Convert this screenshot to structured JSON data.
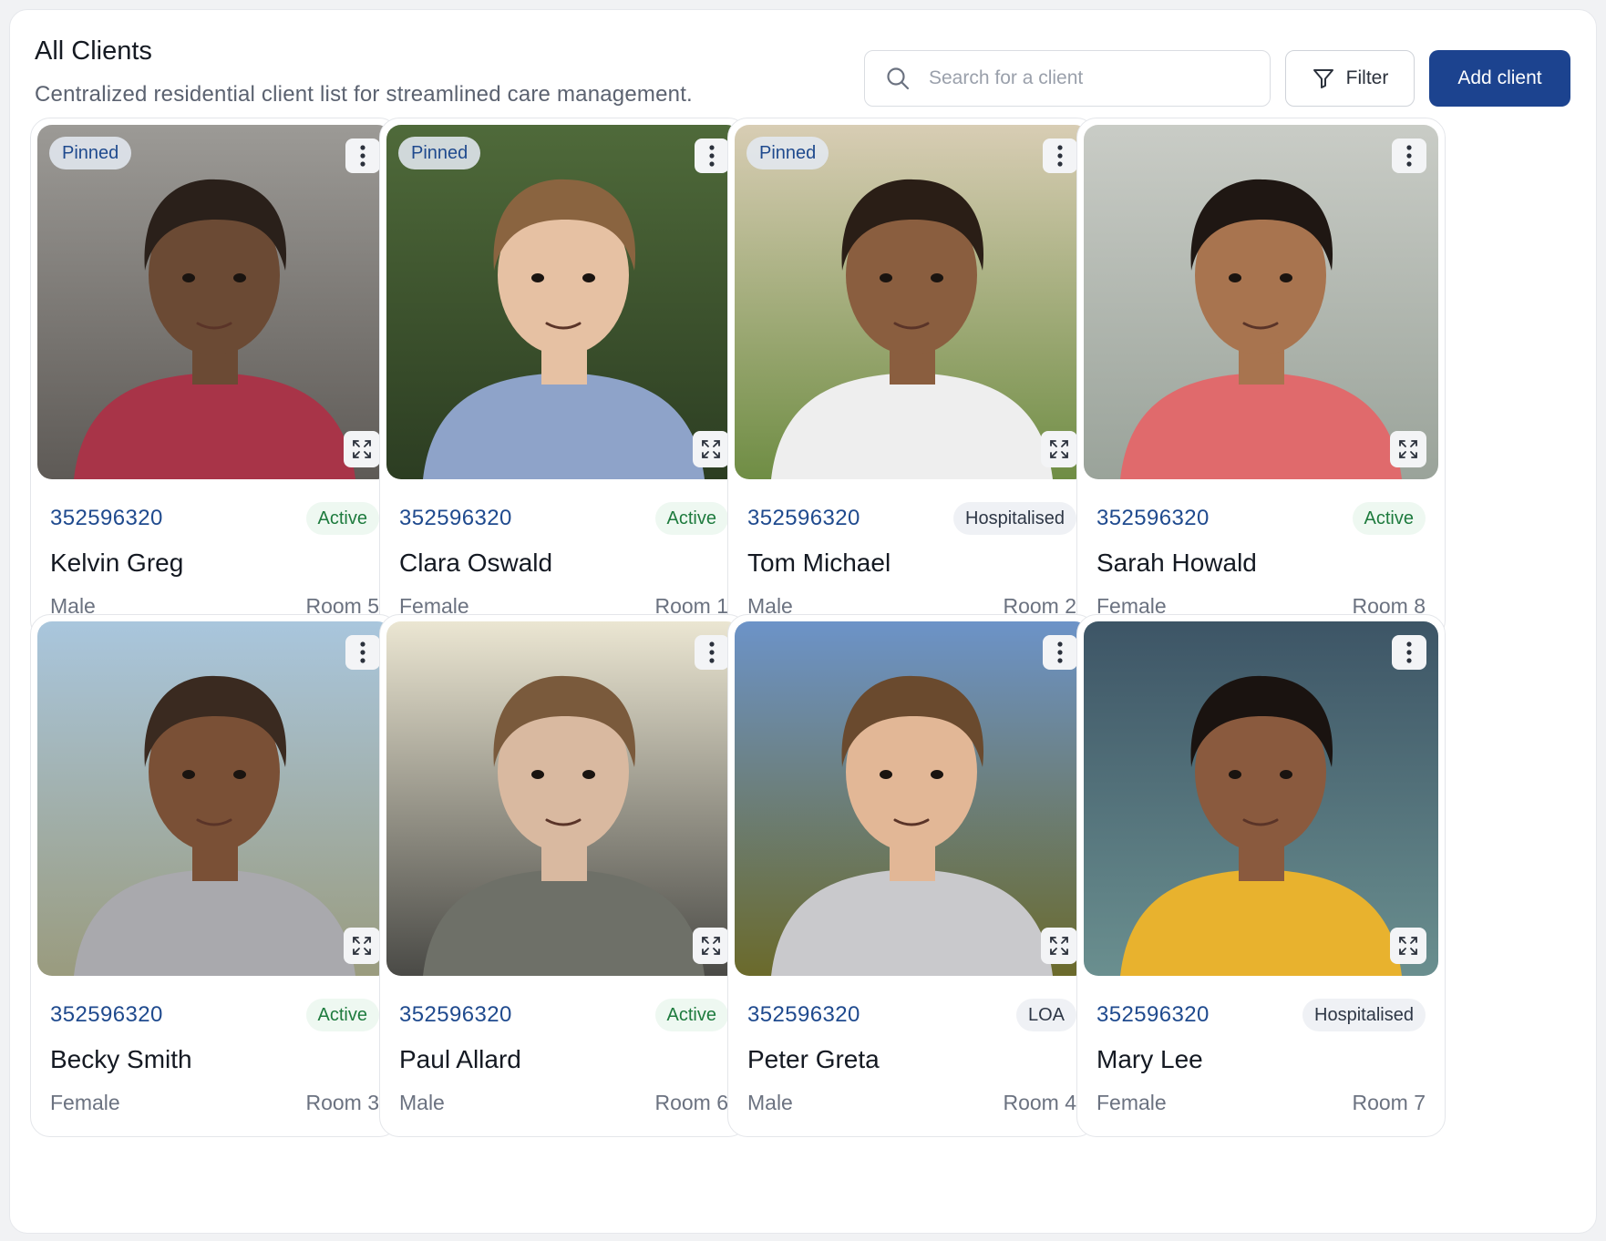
{
  "header": {
    "title": "All Clients",
    "subtitle": "Centralized residential client list for streamlined care management."
  },
  "toolbar": {
    "search_placeholder": "Search for a client",
    "filter_label": "Filter",
    "add_label": "Add client"
  },
  "colors": {
    "accent": "#1c438f",
    "id_text": "#1f4a8e",
    "active_bg": "#eef8f1",
    "active_text": "#1e7b3e",
    "neutral_badge_bg": "#eff1f5"
  },
  "clients": [
    {
      "pinned_label": "Pinned",
      "id": "352596320",
      "status": "Active",
      "name": "Kelvin Greg",
      "gender": "Male",
      "room": "Room 5"
    },
    {
      "pinned_label": "Pinned",
      "id": "352596320",
      "status": "Active",
      "name": "Clara Oswald",
      "gender": "Female",
      "room": "Room 1"
    },
    {
      "pinned_label": "Pinned",
      "id": "352596320",
      "status": "Hospitalised",
      "name": "Tom Michael",
      "gender": "Male",
      "room": "Room 2"
    },
    {
      "pinned_label": "",
      "id": "352596320",
      "status": "Active",
      "name": "Sarah Howald",
      "gender": "Female",
      "room": "Room 8"
    },
    {
      "pinned_label": "",
      "id": "352596320",
      "status": "Active",
      "name": "Becky Smith",
      "gender": "Female",
      "room": "Room 3"
    },
    {
      "pinned_label": "",
      "id": "352596320",
      "status": "Active",
      "name": "Paul Allard",
      "gender": "Male",
      "room": "Room 6"
    },
    {
      "pinned_label": "",
      "id": "352596320",
      "status": "LOA",
      "name": "Peter Greta",
      "gender": "Male",
      "room": "Room 4"
    },
    {
      "pinned_label": "",
      "id": "352596320",
      "status": "Hospitalised",
      "name": "Mary Lee",
      "gender": "Female",
      "room": "Room 7"
    }
  ]
}
